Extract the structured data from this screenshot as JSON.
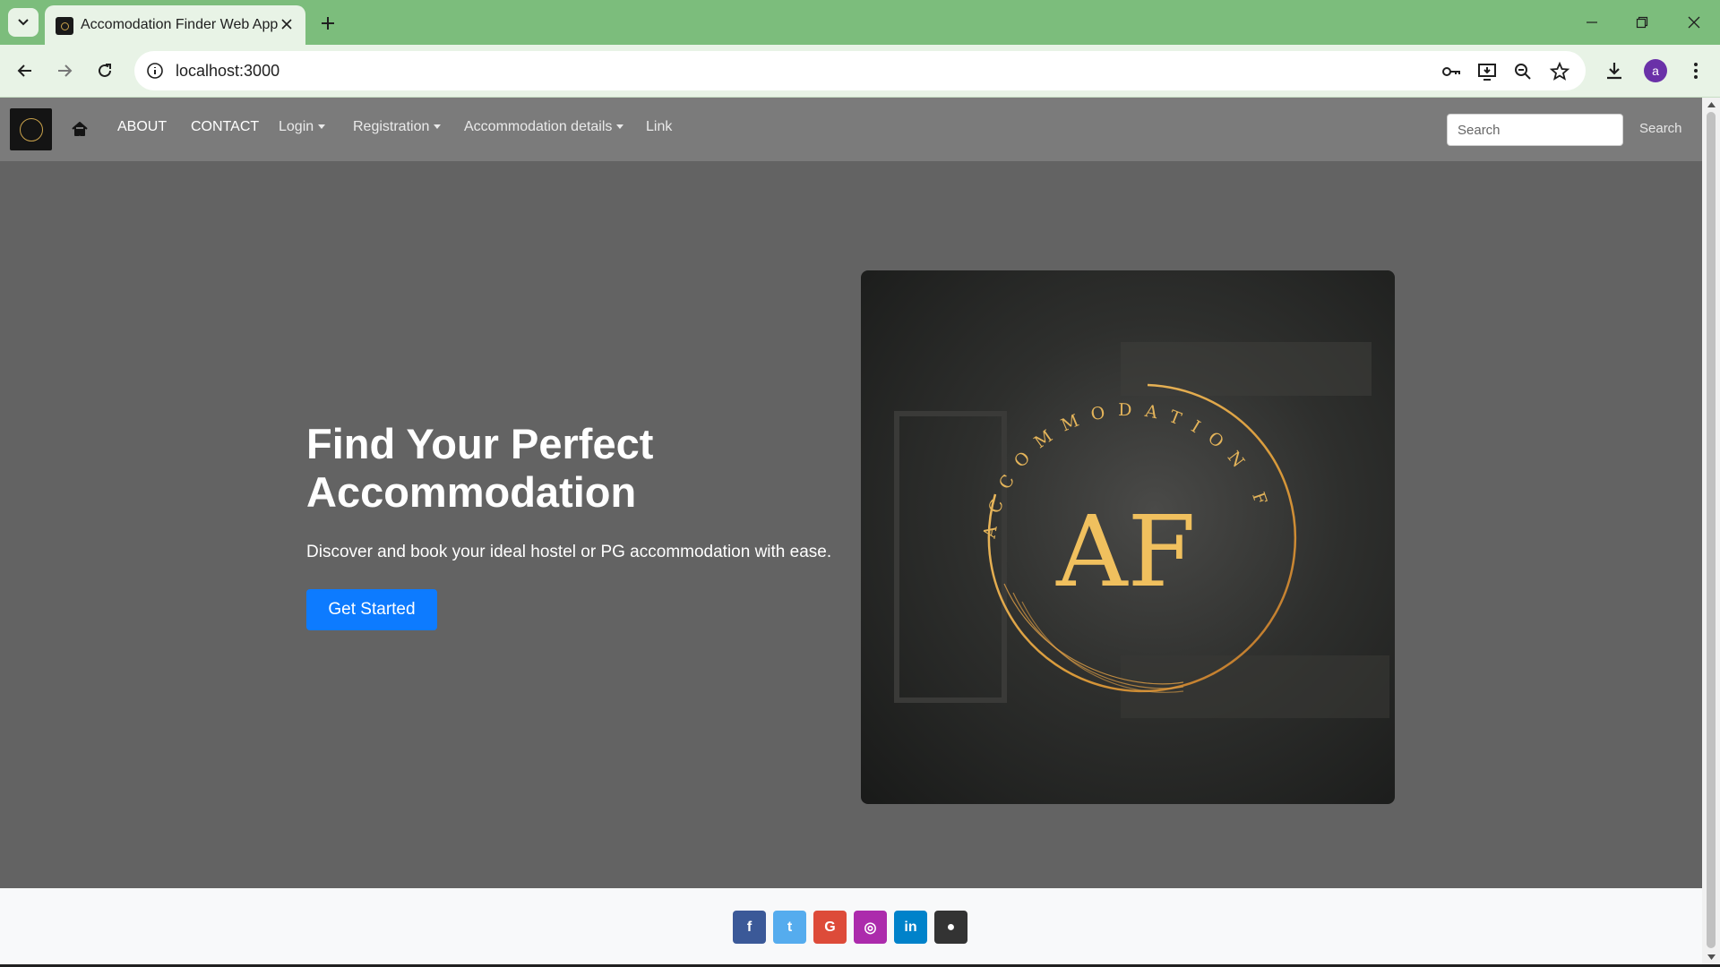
{
  "browser": {
    "tab_title": "Accomodation Finder Web App",
    "url": "localhost:3000",
    "profile_initial": "a"
  },
  "nav": {
    "about": "ABOUT",
    "contact": "CONTACT",
    "login": "Login",
    "registration": "Registration",
    "accommodation_details": "Accommodation details",
    "link": "Link",
    "search_placeholder": "Search",
    "search_button": "Search"
  },
  "hero": {
    "title": "Find Your Perfect Accommodation",
    "subtitle": "Discover and book your ideal hostel or PG accommodation with ease.",
    "cta": "Get Started",
    "logo_text": "ACCOMMODATION FINDER",
    "logo_monogram": "AF"
  },
  "footer": {
    "social": [
      {
        "name": "facebook-icon",
        "glyph": "f",
        "color": "#3b5998"
      },
      {
        "name": "twitter-icon",
        "glyph": "t",
        "color": "#55acee"
      },
      {
        "name": "google-icon",
        "glyph": "G",
        "color": "#dd4b39"
      },
      {
        "name": "instagram-icon",
        "glyph": "◎",
        "color": "#ac2bac"
      },
      {
        "name": "linkedin-icon",
        "glyph": "in",
        "color": "#0082ca"
      },
      {
        "name": "github-icon",
        "glyph": "●",
        "color": "#333333"
      }
    ]
  },
  "colors": {
    "chrome_green": "#7cbd7c",
    "primary_button": "#0d7bff",
    "logo_gold": "#d9a543"
  }
}
